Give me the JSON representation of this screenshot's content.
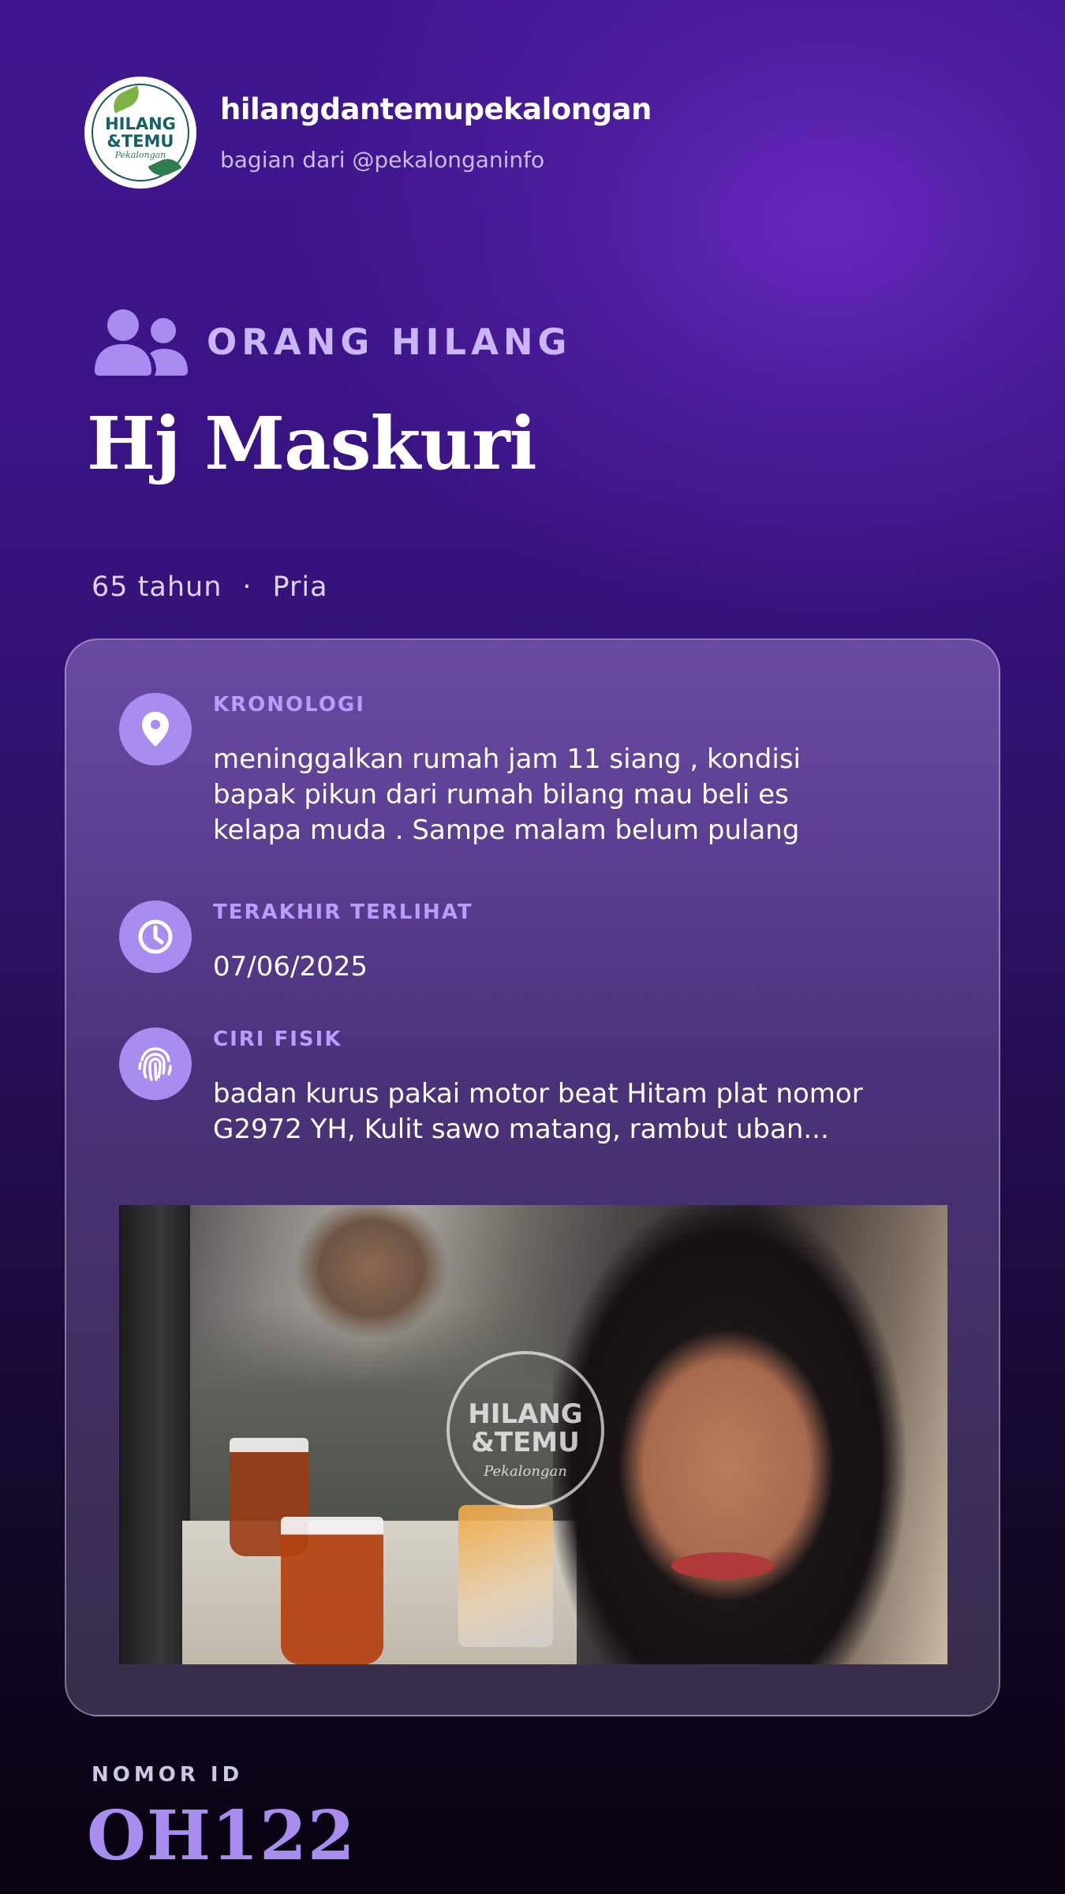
{
  "header": {
    "logo_text": "HILANG & TEMU Pekalongan",
    "account_name": "hilangdantemupekalongan",
    "account_sub": "bagian dari @pekalonganinfo"
  },
  "category": {
    "icon": "users-icon",
    "label": "ORANG HILANG"
  },
  "person": {
    "name": "Hj Maskuri",
    "age": "65 tahun",
    "separator": "·",
    "gender": "Pria"
  },
  "details": [
    {
      "icon": "location-pin-icon",
      "label": "KRONOLOGI",
      "text": "meninggalkan rumah jam 11 siang , kondisi bapak pikun dari rumah bilang mau beli es kelapa muda . Sampe malam belum pulang"
    },
    {
      "icon": "clock-icon",
      "label": "TERAKHIR TERLIHAT",
      "text": "07/06/2025"
    },
    {
      "icon": "fingerprint-icon",
      "label": "CIRI FISIK",
      "text": "badan kurus pakai motor beat Hitam plat nomor G2972 YH, Kulit sawo matang, rambut uban..."
    }
  ],
  "photo": {
    "watermark": "HILANG &TEMU Pekalongan"
  },
  "footer": {
    "id_label": "NOMOR ID",
    "id_value": "OH122"
  },
  "colors": {
    "accent": "#a98cf0",
    "label": "#b99cff",
    "background_top": "#3f1690",
    "background_bottom": "#07030f"
  }
}
